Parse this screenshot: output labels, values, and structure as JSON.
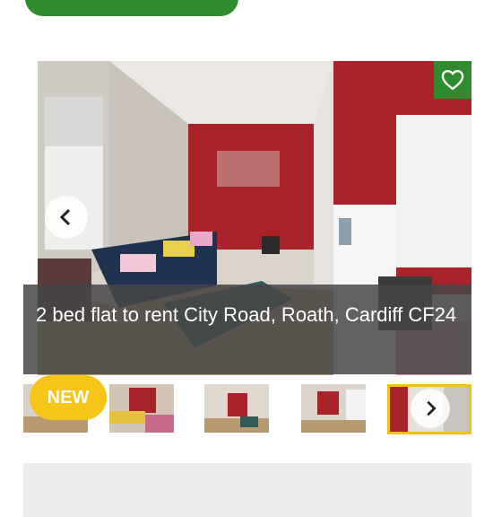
{
  "top_action": {
    "label": ""
  },
  "listing": {
    "title": "2 bed flat to rent City Road, Roath, Cardiff CF24"
  },
  "gallery": {
    "badge": "NEW",
    "thumbnails": [
      "thumb-1",
      "thumb-2",
      "thumb-3",
      "thumb-4",
      "thumb-5"
    ]
  },
  "icons": {
    "favourite": "heart-icon",
    "previous": "chevron-left-icon",
    "next": "chevron-right-icon"
  },
  "colors": {
    "brand_green": "#2e8b2e",
    "badge_yellow": "#f5c518",
    "active_border": "#f2c21b",
    "wall_red": "#a8232a"
  }
}
